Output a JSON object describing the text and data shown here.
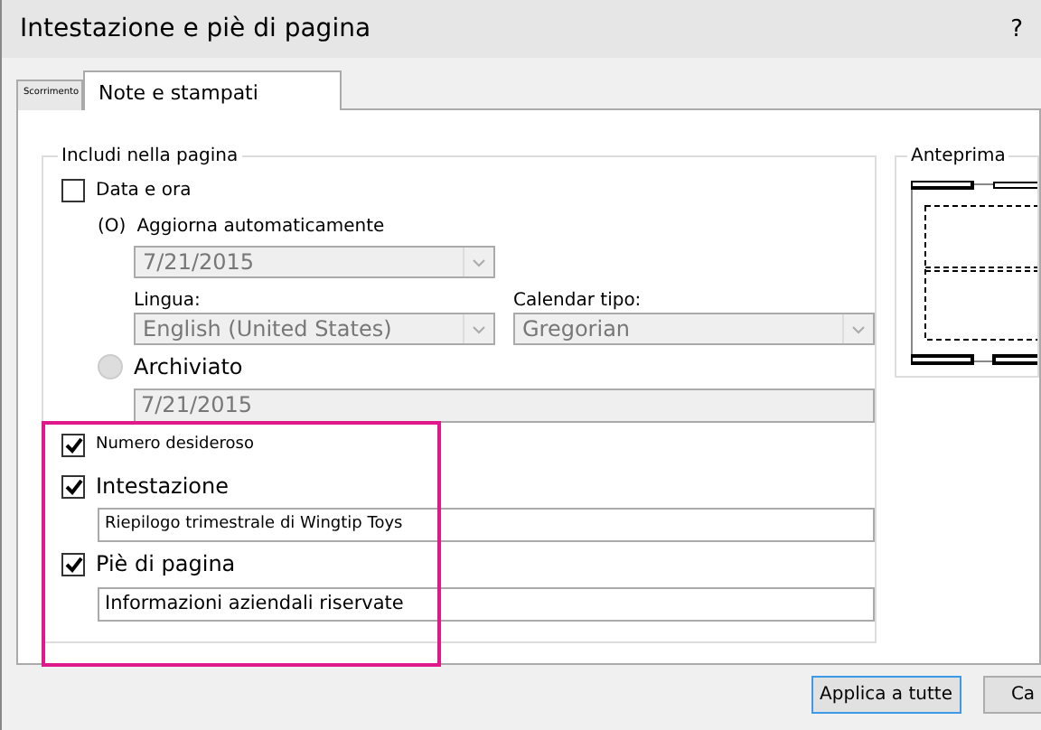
{
  "window": {
    "title": "Intestazione e piè di pagina",
    "help": "?"
  },
  "tabs": [
    {
      "label": "Scorrimento",
      "selected": false
    },
    {
      "label": "Note e stampati",
      "selected": true
    }
  ],
  "include_group": {
    "legend": "Includi nella pagina",
    "date_time": {
      "label": "Data e ora",
      "checked": false
    },
    "auto_update": {
      "marker": "(O)",
      "label": "Aggiorna automaticamente",
      "date": "7/21/2015",
      "language_label": "Lingua:",
      "language": "English (United States)",
      "calendar_label": "Calendar tipo:",
      "calendar": "Gregorian"
    },
    "fixed": {
      "label": "Archiviato",
      "selected": false,
      "date": "7/21/2015"
    },
    "page_number": {
      "label": "Numero desideroso",
      "checked": true
    },
    "header": {
      "label": "Intestazione",
      "checked": true,
      "value": "Riepilogo trimestrale di Wingtip Toys"
    },
    "footer": {
      "label": "Piè di pagina",
      "checked": true,
      "value": "Informazioni aziendali riservate"
    }
  },
  "preview": {
    "legend": "Anteprima"
  },
  "buttons": [
    "Applica a tutte",
    "Ca"
  ]
}
